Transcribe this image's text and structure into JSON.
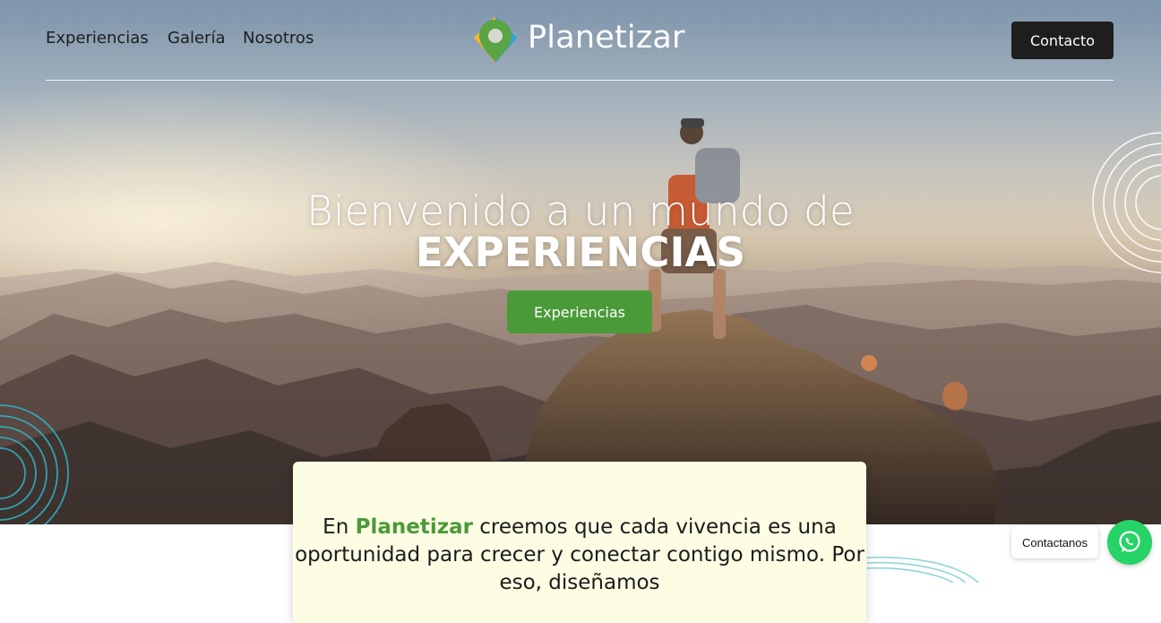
{
  "nav": {
    "links": [
      {
        "label": "Experiencias"
      },
      {
        "label": "Galería"
      },
      {
        "label": "Nosotros"
      }
    ],
    "brand": "Planetizar",
    "contact_label": "Contacto"
  },
  "hero": {
    "title_line1": "Bienvenido a un mundo de",
    "title_line2": "EXPERIENCIAS",
    "cta_label": "Experiencias"
  },
  "intro": {
    "prefix": "En ",
    "brand": "Planetizar",
    "rest": " creemos que cada vivencia es una oportunidad para crecer y conectar contigo mismo. Por eso, diseñamos"
  },
  "whatsapp": {
    "label": "Contactanos",
    "icon": "whatsapp-icon"
  },
  "colors": {
    "accent_green": "#4a9a38",
    "contact_button": "#1e1e1e",
    "card_background": "#fdfde4",
    "whatsapp": "#25d366"
  }
}
